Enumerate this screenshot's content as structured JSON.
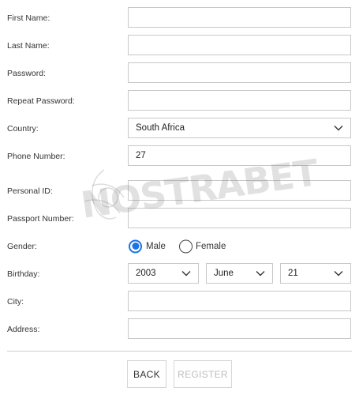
{
  "form": {
    "first_name": {
      "label": "First Name:",
      "value": ""
    },
    "last_name": {
      "label": "Last Name:",
      "value": ""
    },
    "password": {
      "label": "Password:",
      "value": ""
    },
    "repeat_password": {
      "label": "Repeat Password:",
      "value": ""
    },
    "country": {
      "label": "Country:",
      "value": "South Africa",
      "icon": "chevron-down-icon"
    },
    "phone_number": {
      "label": "Phone Number:",
      "value": "27"
    },
    "personal_id": {
      "label": "Personal ID:",
      "value": ""
    },
    "passport_number": {
      "label": "Passport Number:",
      "value": ""
    },
    "gender": {
      "label": "Gender:",
      "options": [
        {
          "label": "Male",
          "selected": true
        },
        {
          "label": "Female",
          "selected": false
        }
      ]
    },
    "birthday": {
      "label": "Birthday:",
      "year": "2003",
      "month": "June",
      "day": "21"
    },
    "city": {
      "label": "City:",
      "value": ""
    },
    "address": {
      "label": "Address:",
      "value": ""
    }
  },
  "buttons": {
    "back": "BACK",
    "register": "REGISTER"
  },
  "watermark": {
    "text": "NOSTRABET"
  },
  "colors": {
    "accent": "#1a73e8",
    "border": "#c8c8c8",
    "disabled_text": "#bdbdbd"
  }
}
